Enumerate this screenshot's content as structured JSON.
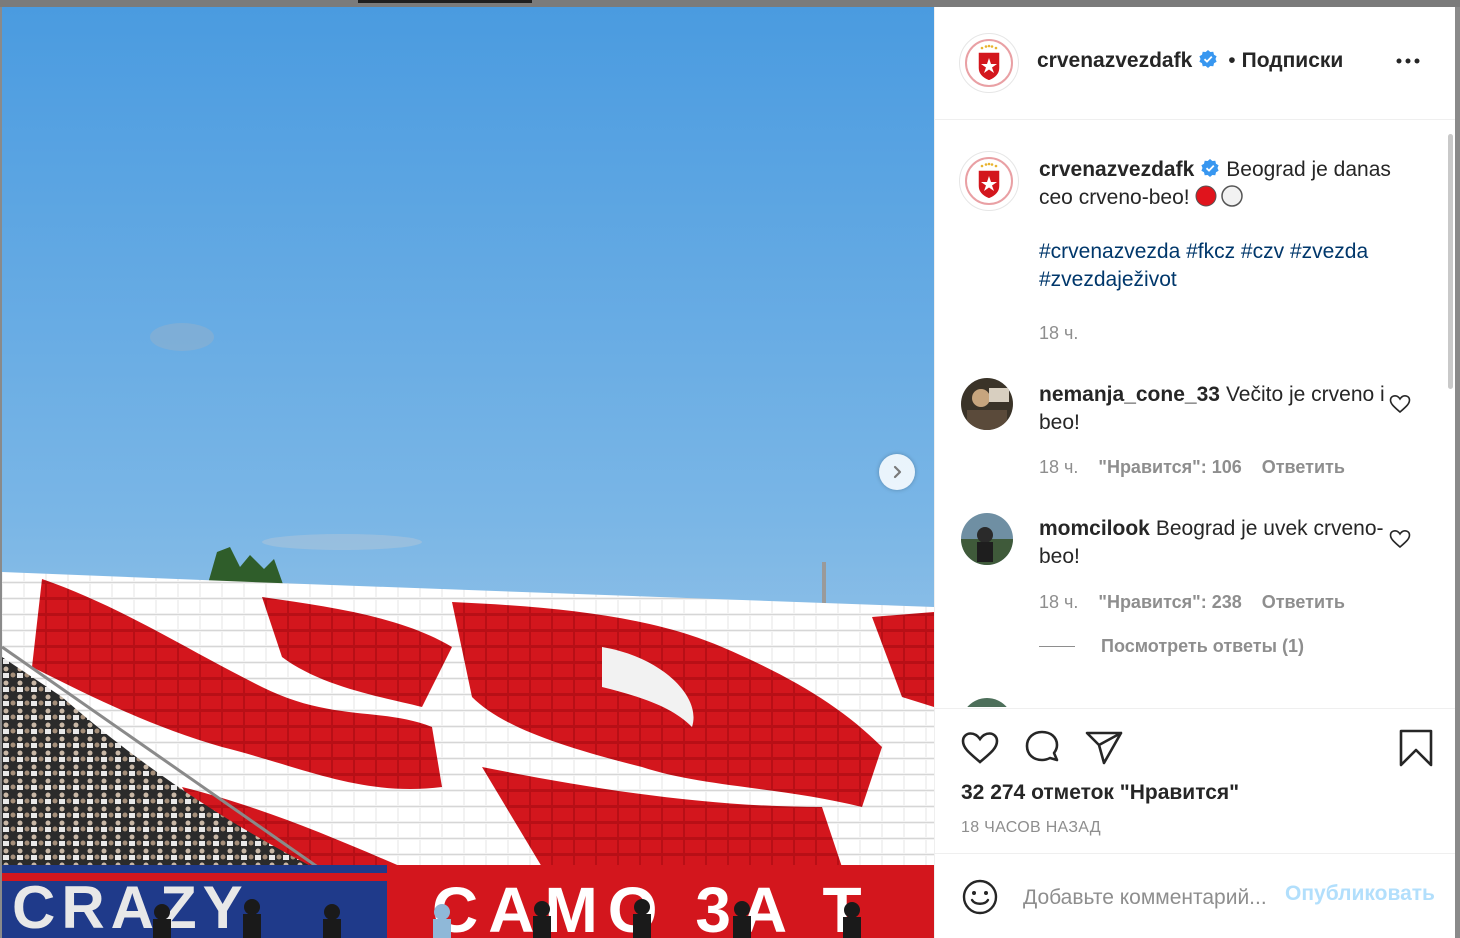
{
  "post": {
    "username": "crvenazvezdafk",
    "follow_separator": "•",
    "follow_label": "Подписки",
    "caption": "Beograd je danas ceo crveno-beo!",
    "hashtags": "#crvenazvezda #fkcz #czv #zvezda #zvezdaježivot",
    "caption_age": "18 ч.",
    "likes": "32 274 отметок \"Нравится\"",
    "time_ago": "18 ЧАСОВ НАЗАД",
    "photo_banner_left": "CRAZY",
    "photo_banner_right": "CAMO 3A T"
  },
  "comments": [
    {
      "username": "nemanja_cone_33",
      "text": "Večito je crveno i beo!",
      "age": "18 ч.",
      "likes": "\"Нравится\": 106",
      "reply": "Ответить"
    },
    {
      "username": "momcilook",
      "text": "Beograd je uvek crveno-beo!",
      "age": "18 ч.",
      "likes": "\"Нравится\": 238",
      "reply": "Ответить",
      "view_replies": "Посмотреть ответы (1)"
    }
  ],
  "add_comment": {
    "placeholder": "Добавьте комментарий...",
    "publish_label": "Опубликовать"
  },
  "colors": {
    "brand_red": "#c8102e",
    "link_blue": "#00376b",
    "verified_blue": "#3897f0",
    "publish_disabled": "#b2dffc"
  }
}
